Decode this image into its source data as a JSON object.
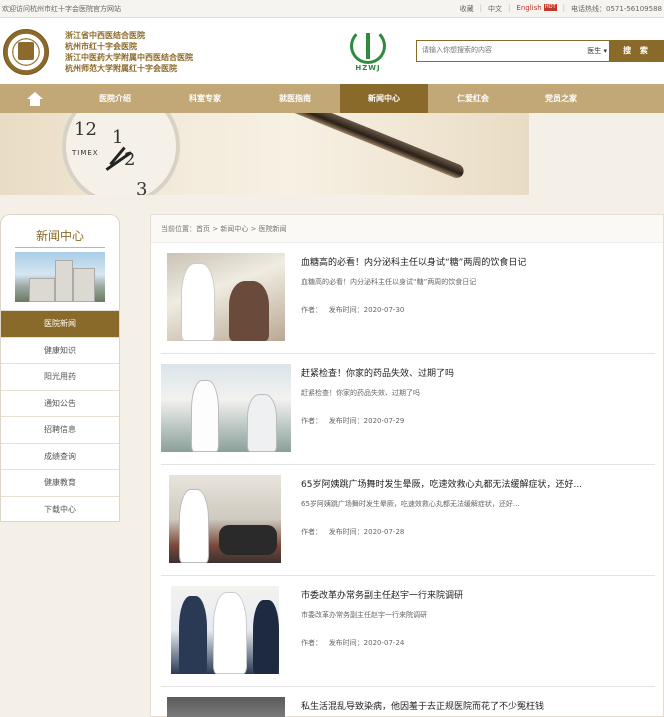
{
  "topbar": {
    "welcome": "欢迎访问杭州市红十字会医院官方网站",
    "links": [
      "收藏",
      "中文",
      "English"
    ],
    "hot_badge": "HOT",
    "hotline": "电话热线：0571-56109588"
  },
  "header": {
    "hospital_names": [
      "浙江省中西医结合医院",
      "杭州市红十字会医院",
      "浙江中医药大学附属中西医结合医院",
      "杭州师范大学附属红十字会医院"
    ],
    "emblem_text": "HZWJ",
    "search_placeholder": "请输入你想搜索的内容",
    "search_select": "医生 ▾",
    "search_button": "搜 索"
  },
  "nav": {
    "items": [
      "医院介绍",
      "科室专家",
      "就医指南",
      "新闻中心",
      "仁爱红会",
      "党员之家"
    ],
    "active": "新闻中心"
  },
  "banner": {
    "clock_label": "TIMEX"
  },
  "sidebar": {
    "title": "新闻中心",
    "items": [
      "医院新闻",
      "健康知识",
      "阳光用药",
      "通知公告",
      "招聘信息",
      "成绩查询",
      "健康教育",
      "下载中心"
    ]
  },
  "breadcrumb": "当前位置：首页 > 新闻中心 > 医院新闻",
  "news": [
    {
      "title": "血糖高的必看！内分泌科主任以身试“糖”两周的饮食日记",
      "summary": "血糖高的必看！内分泌科主任以身试“糖”两周的饮食日记",
      "author": "作者：",
      "date": "发布时间：2020-07-30"
    },
    {
      "title": "赶紧检查！你家的药品失效、过期了吗",
      "summary": "赶紧检查！你家的药品失效、过期了吗",
      "author": "作者：",
      "date": "发布时间：2020-07-29"
    },
    {
      "title": "65岁阿姨跳广场舞时发生晕厥，吃速效救心丸都无法缓解症状，还好...",
      "summary": "65岁阿姨跳广场舞时发生晕厥，吃速效救心丸都无法缓解症状，还好...",
      "author": "作者：",
      "date": "发布时间：2020-07-28"
    },
    {
      "title": "市委改革办常务副主任赵宇一行来院调研",
      "summary": "市委改革办常务副主任赵宇一行来院调研",
      "author": "作者：",
      "date": "发布时间：2020-07-24"
    },
    {
      "title": "私生活混乱导致染病，他因羞于去正规医院而花了不少冤枉钱",
      "summary": "",
      "author": "",
      "date": ""
    }
  ]
}
